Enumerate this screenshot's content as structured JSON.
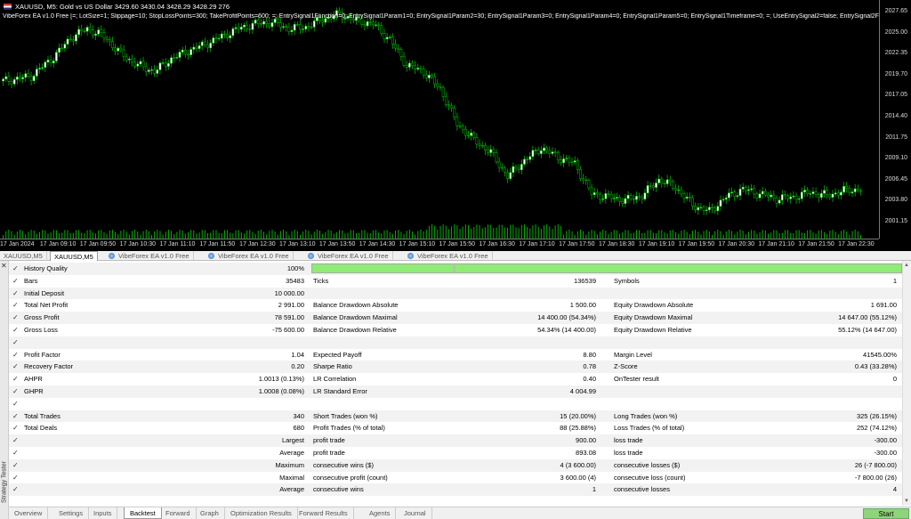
{
  "chart": {
    "symbol_line": "XAUUSD, M5:  Gold vs US Dollar  3429.60 3430.04 3428.29 3428.29  276",
    "params_line": "VibeForex EA v1.0 Free [=; LotSize=1; Slippage=10; StopLossPoints=300; TakeProfitPoints=600; =; EntrySignal1Function=0; EntrySignal1Param1=0; EntrySignal1Param2=30; EntrySignal1Param3=0; EntrySignal1Param4=0; EntrySignal1Param5=0; EntrySignal1Timeframe=0; =; UseEntrySignal2=false; EntrySignal2Function=0;",
    "price_labels": [
      "2027.65",
      "2025.00",
      "2022.35",
      "2019.70",
      "2017.05",
      "2014.40",
      "2011.75",
      "2009.10",
      "2006.45",
      "2003.80",
      "2001.15"
    ],
    "time_labels": [
      "17 Jan 2024",
      "17 Jan 09:10",
      "17 Jan 09:50",
      "17 Jan 10:30",
      "17 Jan 11:10",
      "17 Jan 11:50",
      "17 Jan 12:30",
      "17 Jan 13:10",
      "17 Jan 13:50",
      "17 Jan 14:30",
      "17 Jan 15:10",
      "17 Jan 15:50",
      "17 Jan 16:30",
      "17 Jan 17:10",
      "17 Jan 17:50",
      "17 Jan 18:30",
      "17 Jan 19:10",
      "17 Jan 19:50",
      "17 Jan 20:30",
      "17 Jan 21:10",
      "17 Jan 21:50",
      "17 Jan 22:30"
    ],
    "colors": {
      "background": "#000000",
      "bull": "#ffffff",
      "bear": "#000000",
      "wick": "#00c800",
      "volume": "#00b000"
    }
  },
  "chart_tabs": [
    {
      "label": "XAUUSD,M5",
      "active": false,
      "icon": false
    },
    {
      "label": "XAUUSD,M5",
      "active": true,
      "icon": false
    },
    {
      "label": "VibeForex EA v1.0 Free",
      "active": false,
      "icon": true
    },
    {
      "label": "VibeForex EA v1.0 Free",
      "active": false,
      "icon": true
    },
    {
      "label": "VibeForex EA v1.0 Free",
      "active": false,
      "icon": true
    },
    {
      "label": "VibeForex EA v1.0 Free",
      "active": false,
      "icon": true
    }
  ],
  "tester": {
    "side_label": "Strategy Tester",
    "history_quality": {
      "label": "History Quality",
      "value": "100%",
      "fill": 1.0
    },
    "rows": [
      [
        "Bars",
        "35483",
        "Ticks",
        "136539",
        "Symbols",
        "1"
      ],
      [
        "Initial Deposit",
        "10 000.00",
        "",
        "",
        "",
        ""
      ],
      [
        "Total Net Profit",
        "2 991.00",
        "Balance Drawdown Absolute",
        "1 500.00",
        "Equity Drawdown Absolute",
        "1 691.00"
      ],
      [
        "Gross Profit",
        "78 591.00",
        "Balance Drawdown Maximal",
        "14 400.00 (54.34%)",
        "Equity Drawdown Maximal",
        "14 647.00 (55.12%)"
      ],
      [
        "Gross Loss",
        "-75 600.00",
        "Balance Drawdown Relative",
        "54.34% (14 400.00)",
        "Equity Drawdown Relative",
        "55.12% (14 647.00)"
      ],
      [
        "",
        "",
        "",
        "",
        "",
        ""
      ],
      [
        "Profit Factor",
        "1.04",
        "Expected Payoff",
        "8.80",
        "Margin Level",
        "41545.00%"
      ],
      [
        "Recovery Factor",
        "0.20",
        "Sharpe Ratio",
        "0.78",
        "Z-Score",
        "0.43 (33.28%)"
      ],
      [
        "AHPR",
        "1.0013 (0.13%)",
        "LR Correlation",
        "0.40",
        "OnTester result",
        "0"
      ],
      [
        "GHPR",
        "1.0008 (0.08%)",
        "LR Standard Error",
        "4 004.99",
        "",
        ""
      ],
      [
        "",
        "",
        "",
        "",
        "",
        ""
      ],
      [
        "Total Trades",
        "340",
        "Short Trades (won %)",
        "15 (20.00%)",
        "Long Trades (won %)",
        "325 (26.15%)"
      ],
      [
        "Total Deals",
        "680",
        "Profit Trades (% of total)",
        "88 (25.88%)",
        "Loss Trades (% of total)",
        "252 (74.12%)"
      ],
      [
        "",
        "Largest",
        "profit trade",
        "900.00",
        "loss trade",
        "-300.00"
      ],
      [
        "",
        "Average",
        "profit trade",
        "893.08",
        "loss trade",
        "-300.00"
      ],
      [
        "",
        "Maximum",
        "consecutive wins ($)",
        "4 (3 600.00)",
        "consecutive losses ($)",
        "26 (-7 800.00)"
      ],
      [
        "",
        "Maximal",
        "consecutive profit (count)",
        "3 600.00 (4)",
        "consecutive loss (count)",
        "-7 800.00 (26)"
      ],
      [
        "",
        "Average",
        "consecutive wins",
        "1",
        "consecutive losses",
        "4"
      ]
    ]
  },
  "bottom_tabs": [
    "Overview",
    "Settings",
    "Inputs",
    "Backtest",
    "Forward",
    "Graph",
    "Optimization Results",
    "Forward Results",
    "Agents",
    "Journal"
  ],
  "active_bottom_tab": "Backtest",
  "start_label": "Start",
  "icons": {
    "check": "✓",
    "close": "✕"
  }
}
